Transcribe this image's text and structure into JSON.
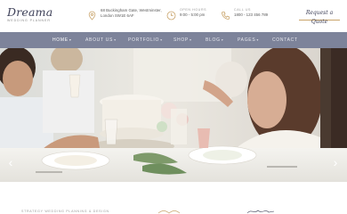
{
  "brand": {
    "name": "Dreama",
    "tagline": "WEDDING PLANNER"
  },
  "header": {
    "address": {
      "line1": "68 Buckingham Gate, Westminster,",
      "line2": "London SW1E 6AF"
    },
    "hours": {
      "label": "OPEN HOURS",
      "value": "9:00 - 5:00 pm"
    },
    "call": {
      "label": "CALL US",
      "value": "1800 - 123 456 789"
    },
    "quote_label": "Request a Quote"
  },
  "nav": {
    "home": "HOME",
    "about": "ABOUT US",
    "portfolio": "PORTFOLIO",
    "shop": "SHOP",
    "blog": "BLOG",
    "pages": "PAGES",
    "contact": "CONTACT",
    "active": "home"
  },
  "hero": {
    "prev_glyph": "‹",
    "next_glyph": "›"
  },
  "below": {
    "caption": "STRATEGY WEDDING PLANNING & DESIGN"
  },
  "colors": {
    "accent": "#c9a46b",
    "nav_bg": "#7d839a",
    "brand": "#3c3f57"
  },
  "icons": {
    "address": "location-pin-icon",
    "hours": "clock-icon",
    "call": "phone-icon"
  }
}
